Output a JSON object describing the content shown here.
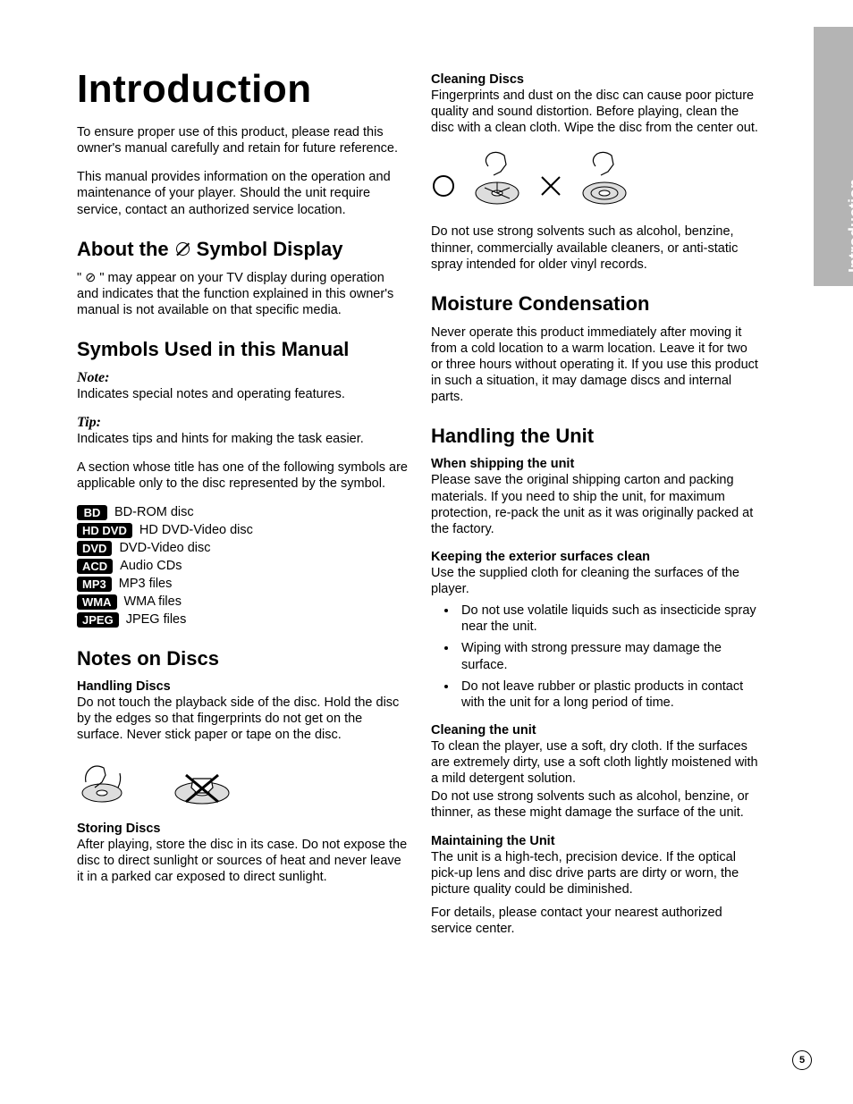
{
  "page_title": "Introduction",
  "tab_label": "Introduction",
  "page_number": "5",
  "intro_p1": "To ensure proper use of this product, please read this owner's manual carefully and retain for future reference.",
  "intro_p2": "This manual provides information on the operation and maintenance of your player. Should the unit require service, contact an authorized service location.",
  "h_about_pre": "About the",
  "h_about_post": "Symbol Display",
  "about_p": "\" ⊘ \" may appear on your TV display during operation and indicates that the function explained in this owner's manual is not available on that specific media.",
  "h_symbols": "Symbols Used in this Manual",
  "note_label": "Note:",
  "note_p": "Indicates special notes and operating features.",
  "tip_label": "Tip:",
  "tip_p": "Indicates tips and hints for making the task easier.",
  "symbols_intro": "A section whose title has one of the following symbols are applicable only to the disc represented by the symbol.",
  "badges": [
    {
      "tag": "BD",
      "desc": "BD-ROM disc"
    },
    {
      "tag": "HD DVD",
      "desc": "HD DVD-Video disc"
    },
    {
      "tag": "DVD",
      "desc": "DVD-Video disc"
    },
    {
      "tag": "ACD",
      "desc": "Audio CDs"
    },
    {
      "tag": "MP3",
      "desc": "MP3 files"
    },
    {
      "tag": "WMA",
      "desc": "WMA files"
    },
    {
      "tag": "JPEG",
      "desc": "JPEG files"
    }
  ],
  "h_notes_discs": "Notes on Discs",
  "h_handling_discs": "Handling Discs",
  "handling_discs_p": "Do not touch the playback side of the disc. Hold the disc by the edges so that fingerprints do not get on the surface. Never stick paper or tape on the disc.",
  "h_storing_discs": "Storing Discs",
  "storing_discs_p": "After playing, store the disc in its case. Do not expose the disc to direct sunlight or sources of heat and never leave it in a parked car exposed to direct sunlight.",
  "h_cleaning_discs": "Cleaning Discs",
  "cleaning_discs_p1": "Fingerprints and dust on the disc can cause poor picture quality and sound distortion. Before playing, clean the disc with a clean cloth. Wipe the disc from the center out.",
  "cleaning_discs_p2": "Do not use strong solvents such as alcohol, benzine, thinner, commercially available cleaners, or anti-static spray intended for older vinyl records.",
  "h_moisture": "Moisture Condensation",
  "moisture_p": "Never operate this product immediately after moving it from a cold location to a warm location. Leave it for two or three hours without operating it. If you use this product in such a situation, it may damage discs and internal parts.",
  "h_handling_unit": "Handling the Unit",
  "h_shipping": "When shipping the unit",
  "shipping_p": "Please save the original shipping carton and packing materials. If you need to ship the unit, for maximum protection, re-pack the unit as it was originally packed at the factory.",
  "h_exterior": "Keeping the exterior surfaces clean",
  "exterior_p": "Use the supplied cloth for cleaning the surfaces of the player.",
  "exterior_bullets": [
    "Do not use volatile liquids such as insecticide spray near the unit.",
    "Wiping with strong pressure may damage the surface.",
    "Do not leave rubber or plastic products in contact with the unit for a long period of time."
  ],
  "h_cleaning_unit": "Cleaning the unit",
  "cleaning_unit_p1": "To clean the player, use a soft, dry cloth. If the surfaces are extremely dirty, use a soft cloth lightly moistened with a mild detergent solution.",
  "cleaning_unit_p2": "Do not use strong solvents such as alcohol, benzine, or thinner, as these might damage the surface of the unit.",
  "h_maintaining": "Maintaining the Unit",
  "maintaining_p1": "The unit is a high-tech, precision device. If the optical pick-up lens and disc drive parts are dirty or worn, the picture quality could be diminished.",
  "maintaining_p2": "For details, please contact your nearest authorized service center."
}
